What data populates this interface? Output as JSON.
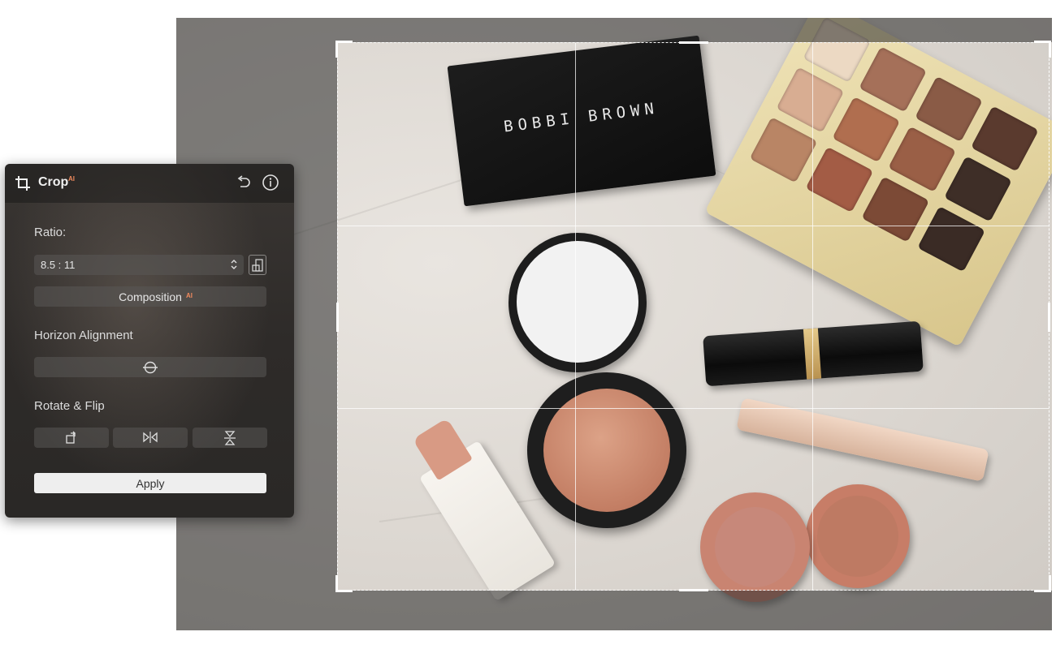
{
  "panel": {
    "title": "Crop",
    "ai_badge": "AI",
    "ratio_label": "Ratio:",
    "ratio_value": "8.5 : 11",
    "composition_label": "Composition",
    "horizon_label": "Horizon Alignment",
    "rotate_flip_label": "Rotate & Flip",
    "apply_label": "Apply"
  },
  "photo": {
    "compact_brand": "BOBBI BROWN"
  },
  "icons": [
    "crop-icon",
    "undo-icon",
    "info-icon",
    "chevron-updown-icon",
    "swap-orientation-icon",
    "horizon-level-icon",
    "rotate-icon",
    "flip-horizontal-icon",
    "flip-vertical-icon"
  ],
  "colors": {
    "accent_ai": "#f08a5d",
    "panel_bg": "#2e2b29",
    "apply_bg": "#eeeeee"
  }
}
